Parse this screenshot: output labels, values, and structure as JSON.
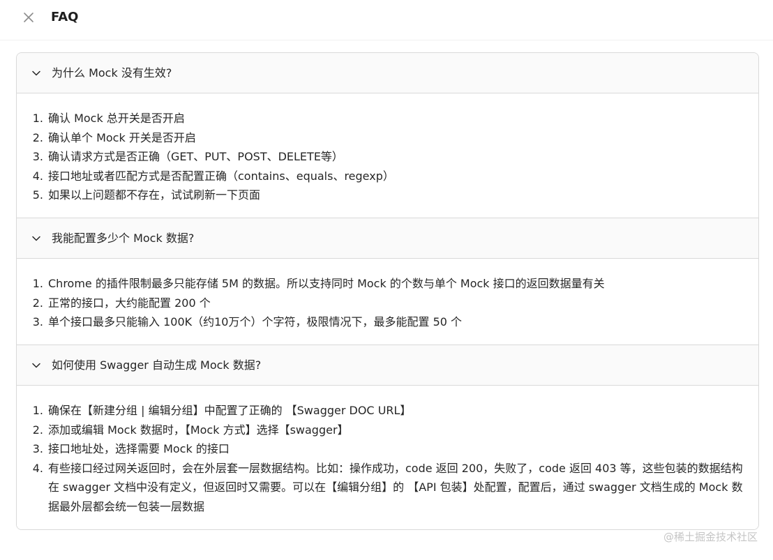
{
  "header": {
    "title": "FAQ",
    "close_icon": "close-icon"
  },
  "faq": [
    {
      "question": "为什么 Mock 没有生效?",
      "answers": [
        "确认 Mock 总开关是否开启",
        "确认单个 Mock 开关是否开启",
        "确认请求方式是否正确（GET、PUT、POST、DELETE等）",
        "接口地址或者匹配方式是否配置正确（contains、equals、regexp）",
        "如果以上问题都不存在，试试刷新一下页面"
      ]
    },
    {
      "question": "我能配置多少个 Mock 数据?",
      "answers": [
        "Chrome 的插件限制最多只能存储 5M 的数据。所以支持同时 Mock 的个数与单个 Mock 接口的返回数据量有关",
        "正常的接口，大约能配置 200 个",
        "单个接口最多只能输入 100K（约10万个）个字符，极限情况下，最多能配置 50 个"
      ]
    },
    {
      "question": "如何使用 Swagger 自动生成 Mock 数据?",
      "answers": [
        "确保在【新建分组 | 编辑分组】中配置了正确的 【Swagger DOC URL】",
        "添加或编辑 Mock 数据时，【Mock 方式】选择【swagger】",
        "接口地址处，选择需要 Mock 的接口",
        "有些接口经过网关返回时，会在外层套一层数据结构。比如：操作成功，code 返回 200，失败了，code 返回 403 等，这些包装的数据结构在 swagger 文档中没有定义，但返回时又需要。可以在【编辑分组】的 【API 包装】处配置，配置后，通过 swagger 文档生成的 Mock 数据最外层都会统一包装一层数据"
      ]
    }
  ],
  "numbers": [
    "1.",
    "2.",
    "3.",
    "4.",
    "5."
  ],
  "watermark": "@稀土掘金技术社区"
}
